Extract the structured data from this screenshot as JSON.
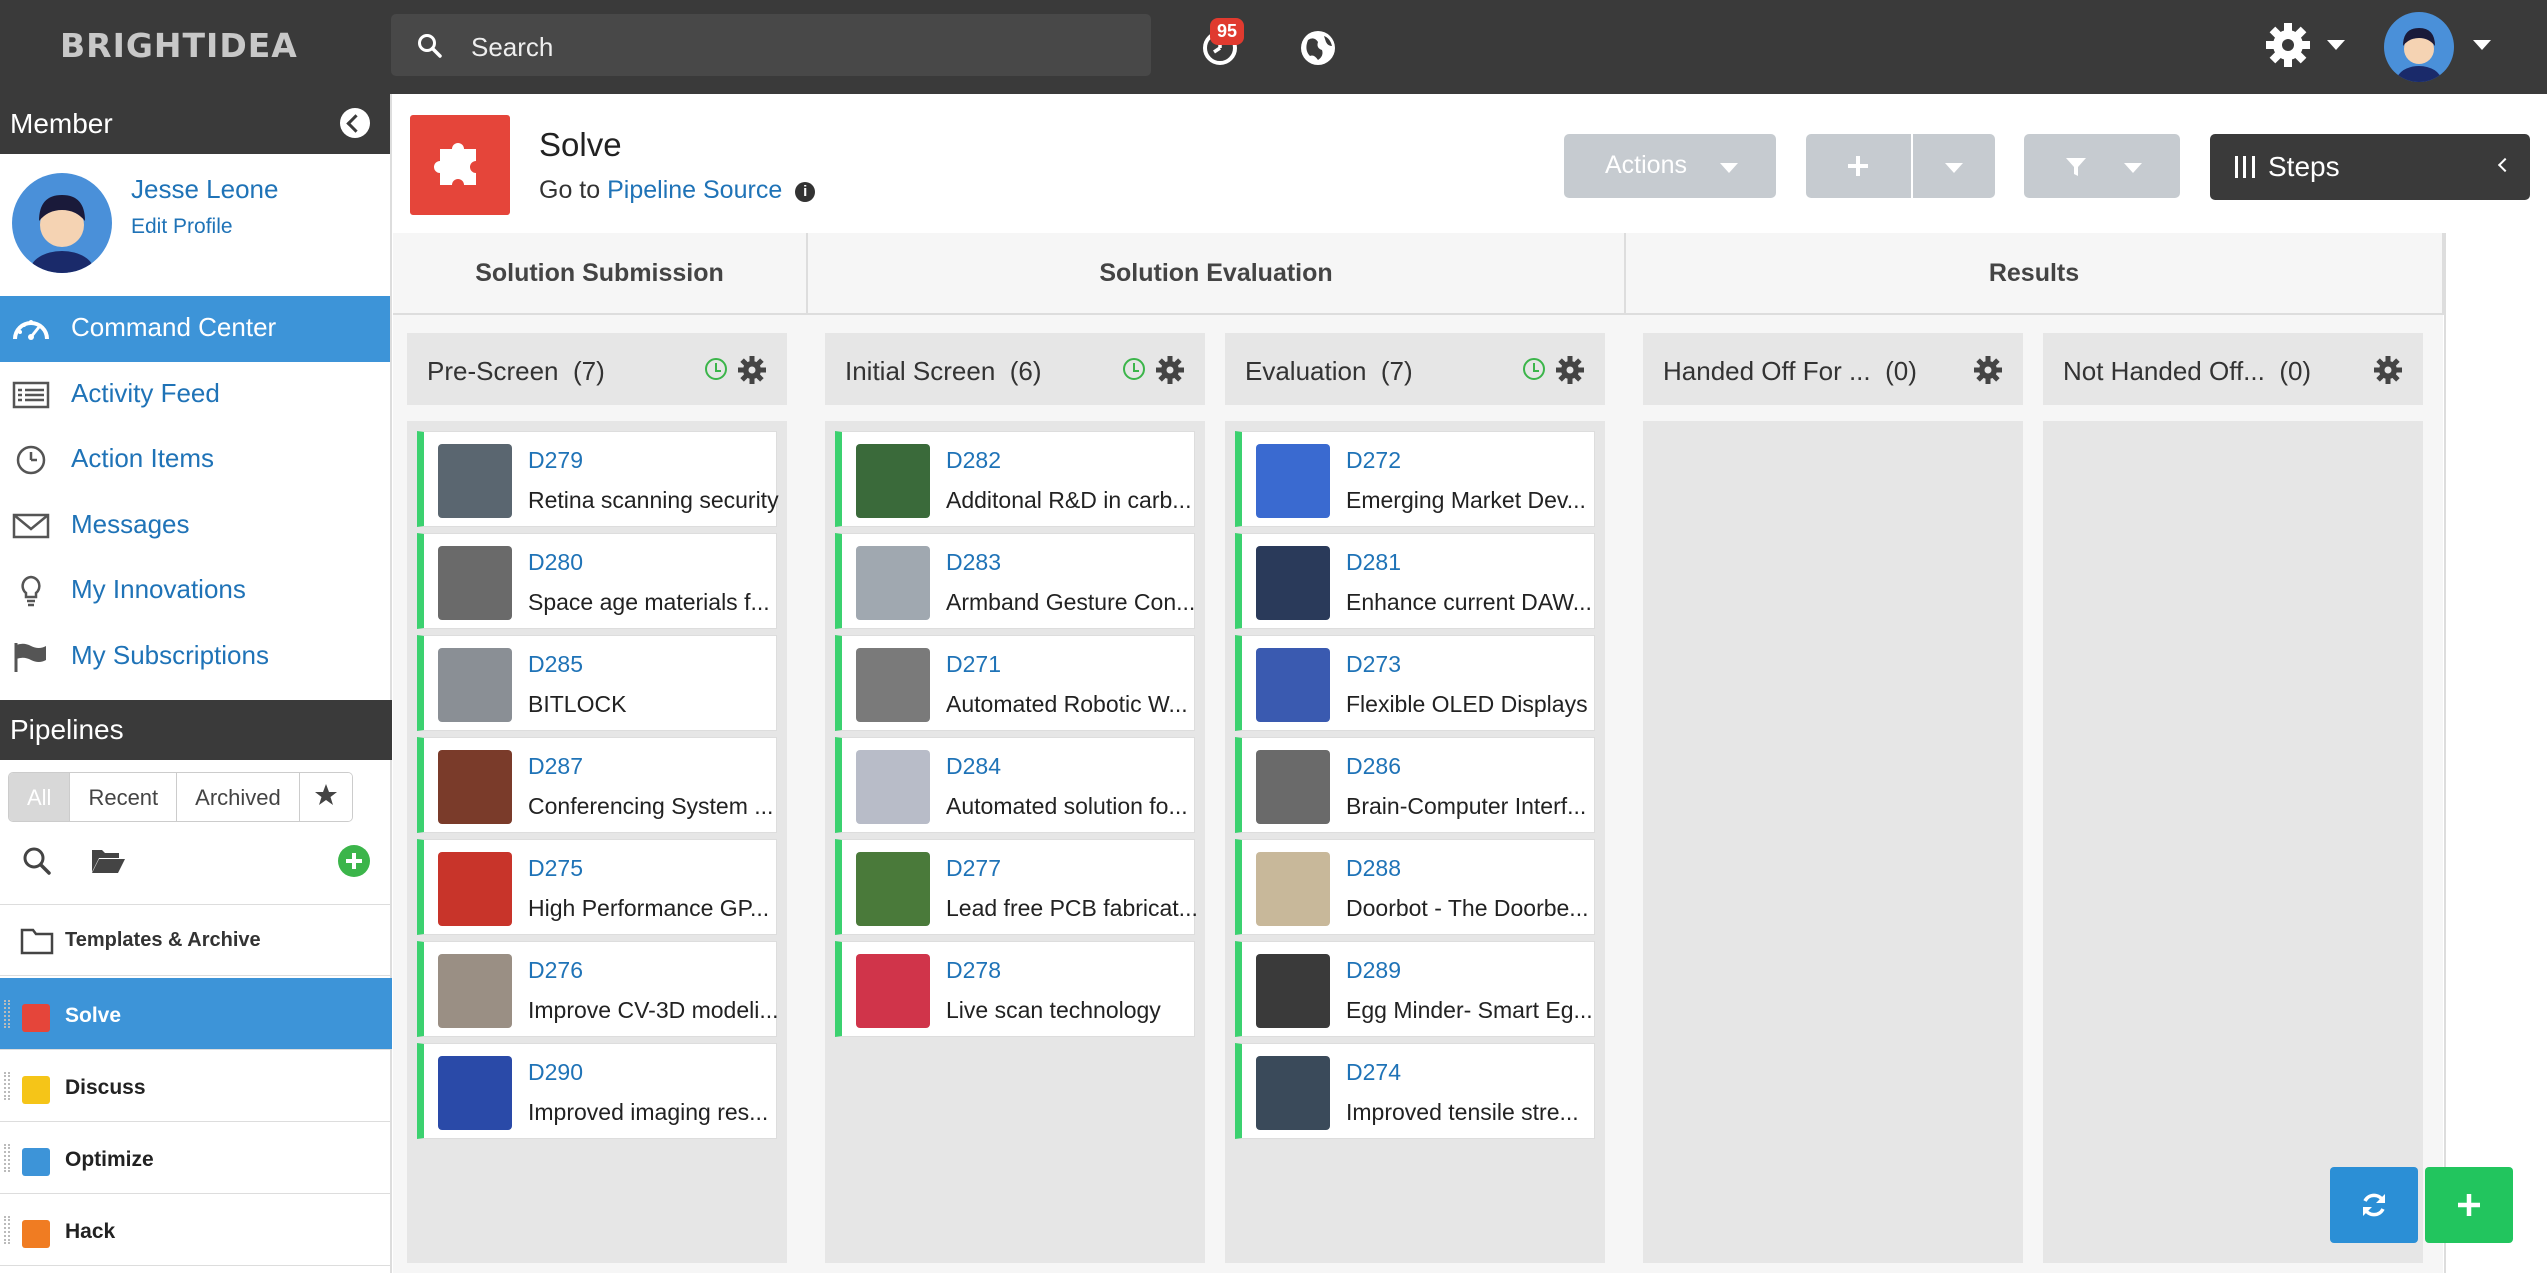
{
  "app": {
    "brand": "BRIGHTIDEA",
    "search_placeholder": "Search",
    "notification_count": "95"
  },
  "sidebar": {
    "member_header": "Member",
    "user_name": "Jesse Leone",
    "edit_profile": "Edit Profile",
    "nav": [
      {
        "label": "Command Center",
        "icon": "dashboard-icon",
        "active": true
      },
      {
        "label": "Activity Feed",
        "icon": "list-icon"
      },
      {
        "label": "Action Items",
        "icon": "clock-icon"
      },
      {
        "label": "Messages",
        "icon": "envelope-icon"
      },
      {
        "label": "My Innovations",
        "icon": "lightbulb-icon"
      },
      {
        "label": "My Subscriptions",
        "icon": "flag-icon"
      }
    ],
    "pipelines_header": "Pipelines",
    "filters": [
      "All",
      "Recent",
      "Archived"
    ],
    "templates_label": "Templates & Archive",
    "pipelines": [
      {
        "label": "Solve",
        "color": "#e5453a",
        "active": true
      },
      {
        "label": "Discuss",
        "color": "#f5c518"
      },
      {
        "label": "Optimize",
        "color": "#3d94d8"
      },
      {
        "label": "Hack",
        "color": "#f07c22"
      }
    ]
  },
  "header": {
    "title": "Solve",
    "goto_prefix": "Go to",
    "goto_link": "Pipeline Source",
    "actions_label": "Actions",
    "steps_label": "Steps"
  },
  "board": {
    "groups": [
      "Solution Submission",
      "Solution Evaluation",
      "Results"
    ],
    "columns": [
      {
        "title": "Pre-Screen",
        "count": "(7)",
        "cards": [
          {
            "id": "D279",
            "title": "Retina scanning security",
            "thumb": "#5a6670"
          },
          {
            "id": "D280",
            "title": "Space age materials f...",
            "thumb": "#6a6a6a"
          },
          {
            "id": "D285",
            "title": "BITLOCK",
            "thumb": "#8a8f95"
          },
          {
            "id": "D287",
            "title": "Conferencing System ...",
            "thumb": "#7a3b2a"
          },
          {
            "id": "D275",
            "title": "High Performance GP...",
            "thumb": "#c8342a"
          },
          {
            "id": "D276",
            "title": "Improve CV-3D modeli...",
            "thumb": "#9a8f84"
          },
          {
            "id": "D290",
            "title": "Improved imaging res...",
            "thumb": "#2a4aa8"
          }
        ]
      },
      {
        "title": "Initial Screen",
        "count": "(6)",
        "cards": [
          {
            "id": "D282",
            "title": "Additonal R&D in carb...",
            "thumb": "#3a6a3a"
          },
          {
            "id": "D283",
            "title": "Armband Gesture Con...",
            "thumb": "#a0a8b0"
          },
          {
            "id": "D271",
            "title": "Automated Robotic W...",
            "thumb": "#7a7a7a"
          },
          {
            "id": "D284",
            "title": "Automated solution fo...",
            "thumb": "#b8bcc8"
          },
          {
            "id": "D277",
            "title": "Lead free PCB fabricat...",
            "thumb": "#4a7a3a"
          },
          {
            "id": "D278",
            "title": "Live scan technology",
            "thumb": "#d0344a"
          }
        ]
      },
      {
        "title": "Evaluation",
        "count": "(7)",
        "cards": [
          {
            "id": "D272",
            "title": "Emerging Market Dev...",
            "thumb": "#3a6ad0"
          },
          {
            "id": "D281",
            "title": "Enhance current DAW...",
            "thumb": "#2a3a5a"
          },
          {
            "id": "D273",
            "title": "Flexible OLED Displays",
            "thumb": "#3a5ab0"
          },
          {
            "id": "D286",
            "title": "Brain-Computer Interf...",
            "thumb": "#6a6a6a"
          },
          {
            "id": "D288",
            "title": "Doorbot - The Doorbe...",
            "thumb": "#c8b89a"
          },
          {
            "id": "D289",
            "title": "Egg Minder- Smart Eg...",
            "thumb": "#3a3a3a"
          },
          {
            "id": "D274",
            "title": "Improved tensile stre...",
            "thumb": "#3a4a5a"
          }
        ]
      },
      {
        "title": "Handed Off For ...",
        "count": "(0)",
        "cards": []
      },
      {
        "title": "Not Handed Off...",
        "count": "(0)",
        "cards": []
      }
    ]
  }
}
